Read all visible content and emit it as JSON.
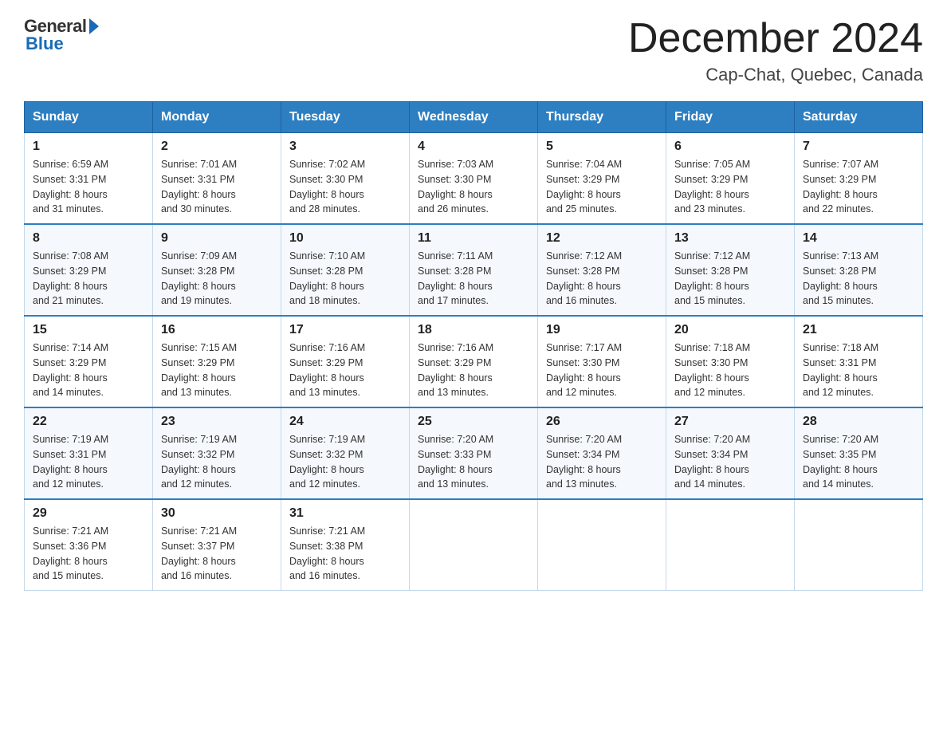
{
  "header": {
    "logo_general": "General",
    "logo_blue": "Blue",
    "month_title": "December 2024",
    "location": "Cap-Chat, Quebec, Canada"
  },
  "weekdays": [
    "Sunday",
    "Monday",
    "Tuesday",
    "Wednesday",
    "Thursday",
    "Friday",
    "Saturday"
  ],
  "weeks": [
    [
      {
        "day": "1",
        "sunrise": "6:59 AM",
        "sunset": "3:31 PM",
        "daylight": "8 hours and 31 minutes."
      },
      {
        "day": "2",
        "sunrise": "7:01 AM",
        "sunset": "3:31 PM",
        "daylight": "8 hours and 30 minutes."
      },
      {
        "day": "3",
        "sunrise": "7:02 AM",
        "sunset": "3:30 PM",
        "daylight": "8 hours and 28 minutes."
      },
      {
        "day": "4",
        "sunrise": "7:03 AM",
        "sunset": "3:30 PM",
        "daylight": "8 hours and 26 minutes."
      },
      {
        "day": "5",
        "sunrise": "7:04 AM",
        "sunset": "3:29 PM",
        "daylight": "8 hours and 25 minutes."
      },
      {
        "day": "6",
        "sunrise": "7:05 AM",
        "sunset": "3:29 PM",
        "daylight": "8 hours and 23 minutes."
      },
      {
        "day": "7",
        "sunrise": "7:07 AM",
        "sunset": "3:29 PM",
        "daylight": "8 hours and 22 minutes."
      }
    ],
    [
      {
        "day": "8",
        "sunrise": "7:08 AM",
        "sunset": "3:29 PM",
        "daylight": "8 hours and 21 minutes."
      },
      {
        "day": "9",
        "sunrise": "7:09 AM",
        "sunset": "3:28 PM",
        "daylight": "8 hours and 19 minutes."
      },
      {
        "day": "10",
        "sunrise": "7:10 AM",
        "sunset": "3:28 PM",
        "daylight": "8 hours and 18 minutes."
      },
      {
        "day": "11",
        "sunrise": "7:11 AM",
        "sunset": "3:28 PM",
        "daylight": "8 hours and 17 minutes."
      },
      {
        "day": "12",
        "sunrise": "7:12 AM",
        "sunset": "3:28 PM",
        "daylight": "8 hours and 16 minutes."
      },
      {
        "day": "13",
        "sunrise": "7:12 AM",
        "sunset": "3:28 PM",
        "daylight": "8 hours and 15 minutes."
      },
      {
        "day": "14",
        "sunrise": "7:13 AM",
        "sunset": "3:28 PM",
        "daylight": "8 hours and 15 minutes."
      }
    ],
    [
      {
        "day": "15",
        "sunrise": "7:14 AM",
        "sunset": "3:29 PM",
        "daylight": "8 hours and 14 minutes."
      },
      {
        "day": "16",
        "sunrise": "7:15 AM",
        "sunset": "3:29 PM",
        "daylight": "8 hours and 13 minutes."
      },
      {
        "day": "17",
        "sunrise": "7:16 AM",
        "sunset": "3:29 PM",
        "daylight": "8 hours and 13 minutes."
      },
      {
        "day": "18",
        "sunrise": "7:16 AM",
        "sunset": "3:29 PM",
        "daylight": "8 hours and 13 minutes."
      },
      {
        "day": "19",
        "sunrise": "7:17 AM",
        "sunset": "3:30 PM",
        "daylight": "8 hours and 12 minutes."
      },
      {
        "day": "20",
        "sunrise": "7:18 AM",
        "sunset": "3:30 PM",
        "daylight": "8 hours and 12 minutes."
      },
      {
        "day": "21",
        "sunrise": "7:18 AM",
        "sunset": "3:31 PM",
        "daylight": "8 hours and 12 minutes."
      }
    ],
    [
      {
        "day": "22",
        "sunrise": "7:19 AM",
        "sunset": "3:31 PM",
        "daylight": "8 hours and 12 minutes."
      },
      {
        "day": "23",
        "sunrise": "7:19 AM",
        "sunset": "3:32 PM",
        "daylight": "8 hours and 12 minutes."
      },
      {
        "day": "24",
        "sunrise": "7:19 AM",
        "sunset": "3:32 PM",
        "daylight": "8 hours and 12 minutes."
      },
      {
        "day": "25",
        "sunrise": "7:20 AM",
        "sunset": "3:33 PM",
        "daylight": "8 hours and 13 minutes."
      },
      {
        "day": "26",
        "sunrise": "7:20 AM",
        "sunset": "3:34 PM",
        "daylight": "8 hours and 13 minutes."
      },
      {
        "day": "27",
        "sunrise": "7:20 AM",
        "sunset": "3:34 PM",
        "daylight": "8 hours and 14 minutes."
      },
      {
        "day": "28",
        "sunrise": "7:20 AM",
        "sunset": "3:35 PM",
        "daylight": "8 hours and 14 minutes."
      }
    ],
    [
      {
        "day": "29",
        "sunrise": "7:21 AM",
        "sunset": "3:36 PM",
        "daylight": "8 hours and 15 minutes."
      },
      {
        "day": "30",
        "sunrise": "7:21 AM",
        "sunset": "3:37 PM",
        "daylight": "8 hours and 16 minutes."
      },
      {
        "day": "31",
        "sunrise": "7:21 AM",
        "sunset": "3:38 PM",
        "daylight": "8 hours and 16 minutes."
      },
      null,
      null,
      null,
      null
    ]
  ],
  "labels": {
    "sunrise": "Sunrise:",
    "sunset": "Sunset:",
    "daylight": "Daylight:"
  }
}
